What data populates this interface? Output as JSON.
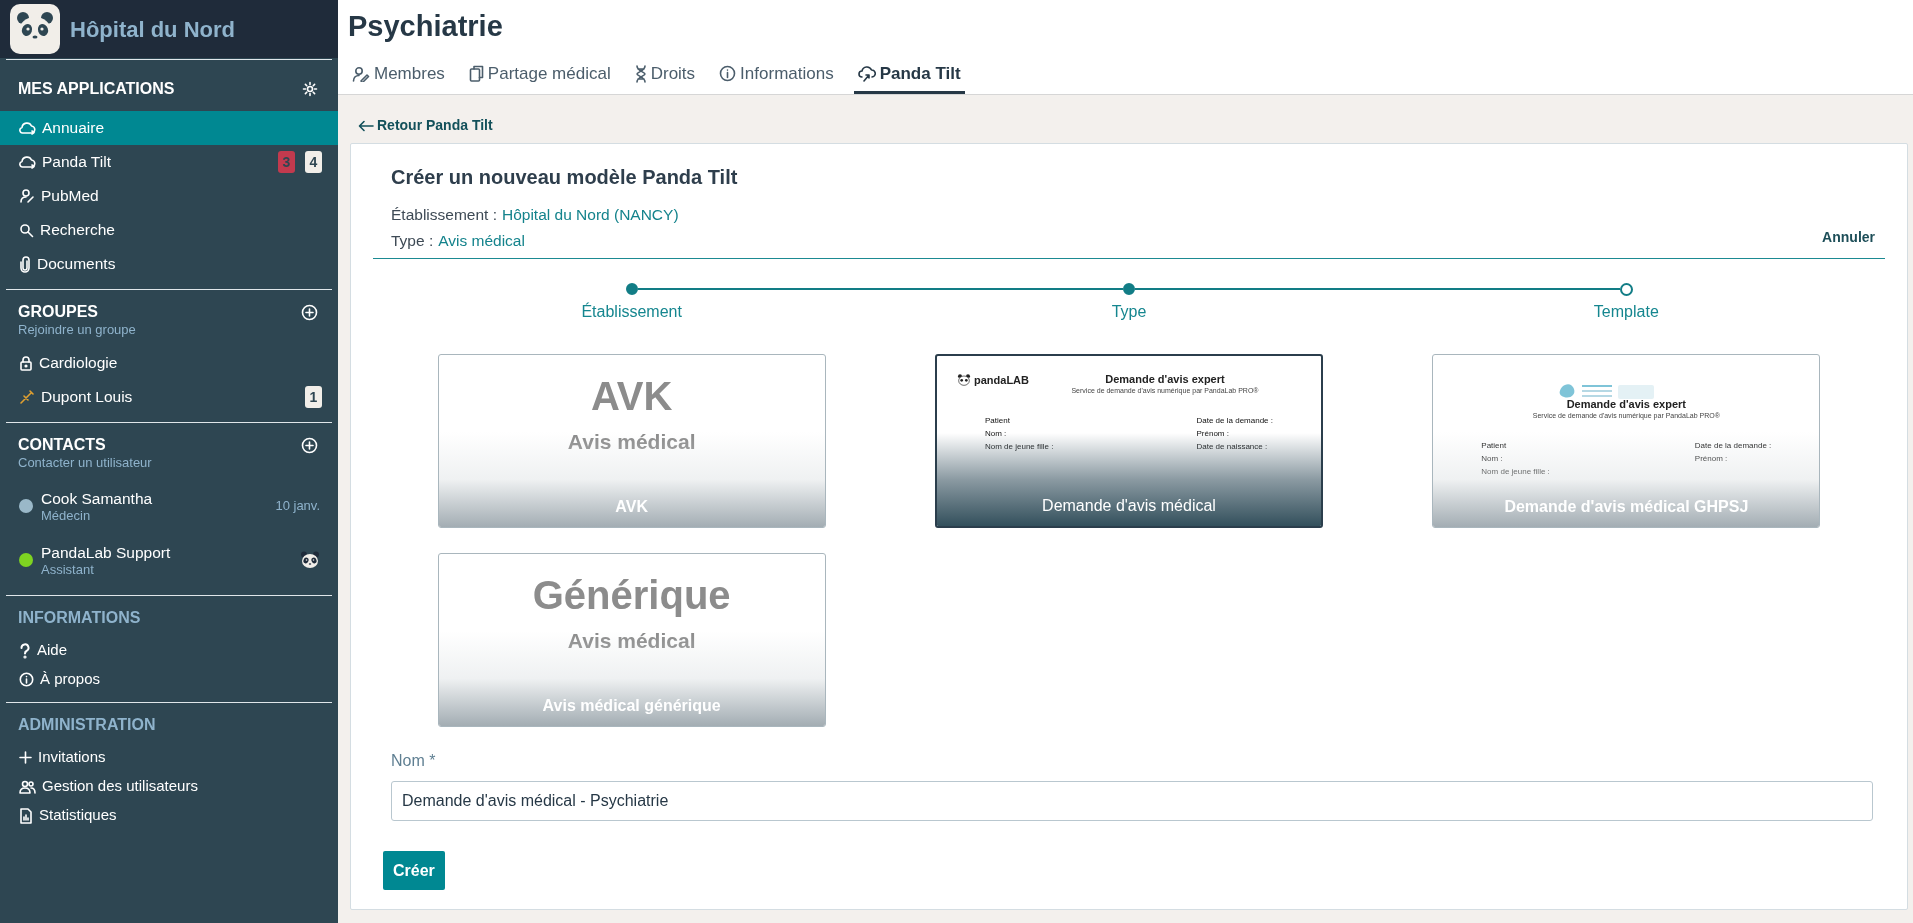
{
  "sidebar": {
    "org_name": "Hôpital du Nord",
    "sections": [
      {
        "title": "MES APPLICATIONS",
        "active": true,
        "items": [
          {
            "label": "Annuaire",
            "selected": true
          },
          {
            "label": "Panda Tilt",
            "selected": false,
            "badges": [
              {
                "text": "3",
                "color": "#c23a4e"
              },
              {
                "text": "4",
                "color": "#f1eee9"
              }
            ]
          },
          {
            "label": "PubMed",
            "selected": false
          },
          {
            "label": "Recherche",
            "selected": false
          },
          {
            "label": "Documents",
            "selected": false
          }
        ]
      },
      {
        "title": "GROUPES",
        "subtitle": "Rejoindre un groupe",
        "active": true,
        "items": [
          {
            "label": "Cardiologie",
            "selected": false
          },
          {
            "label": "Dupont Louis",
            "selected": false,
            "badges": [
              {
                "text": "1",
                "color": "#f1eee9"
              }
            ]
          }
        ]
      },
      {
        "title": "CONTACTS",
        "subtitle": "Contacter un utilisateur",
        "active": true,
        "contacts": [
          {
            "name": "Cook Samantha",
            "role": "Médecin",
            "color": "#9ab8c8",
            "date": "10 janv.",
            "has_avatar": false
          },
          {
            "name": "PandaLab Support",
            "role": "Assistant",
            "color": "#7ed321",
            "has_avatar": true
          }
        ]
      },
      {
        "title": "INFORMATIONS",
        "active": false,
        "items": [
          {
            "label": "Aide",
            "selected": false
          },
          {
            "label": "À propos",
            "selected": false
          }
        ]
      },
      {
        "title": "ADMINISTRATION",
        "active": false,
        "items": [
          {
            "label": "Invitations",
            "selected": false
          },
          {
            "label": "Gestion des utilisateurs",
            "selected": false
          },
          {
            "label": "Statistiques",
            "selected": false
          }
        ]
      }
    ]
  },
  "main": {
    "page_title": "Psychiatrie",
    "tabs": [
      {
        "label": "Membres",
        "selected": false
      },
      {
        "label": "Partage médical",
        "selected": false
      },
      {
        "label": "Droits",
        "selected": false
      },
      {
        "label": "Informations",
        "selected": false
      },
      {
        "label": "Panda Tilt",
        "selected": true
      }
    ],
    "back_link": "Retour Panda Tilt",
    "form": {
      "title": "Créer un nouveau modèle Panda Tilt",
      "establishment_label": "Établissement :",
      "establishment_value": "Hôpital du Nord (NANCY)",
      "type_label": "Type :",
      "type_value": "Avis médical",
      "cancel": "Annuler",
      "steps": [
        {
          "label": "Établissement",
          "done": true
        },
        {
          "label": "Type",
          "done": true
        },
        {
          "label": "Template",
          "done": false
        }
      ],
      "templates": [
        {
          "kind": "text",
          "selected": false,
          "title": "AVK",
          "subtitle": "Avis médical",
          "caption": "AVK"
        },
        {
          "kind": "document",
          "selected": true,
          "logo_text": "pandaLAB",
          "heading": "Demande d'avis expert",
          "subheading": "Service de demande d'avis numérique par PandaLab PRO®",
          "fields_left": [
            "Patient",
            "Nom :",
            "Nom de jeune fille :"
          ],
          "fields_right": [
            "Date de la demande :",
            "Prénom :",
            "Date de naissance :"
          ],
          "caption": "Demande d'avis médical"
        },
        {
          "kind": "document",
          "selected": false,
          "heading": "Demande d'avis expert",
          "subheading": "Service de demande d'avis numérique par PandaLab PRO®",
          "fields_left": [
            "Patient",
            "Nom :",
            "Nom de jeune fille :"
          ],
          "fields_right": [
            "Date de la demande :",
            "Prénom :"
          ],
          "caption": "Demande d'avis médical GHPSJ"
        },
        {
          "kind": "text",
          "selected": false,
          "title": "Générique",
          "subtitle": "Avis médical",
          "caption": "Avis médical générique"
        }
      ],
      "name_label": "Nom *",
      "name_value": "Demande d'avis médical - Psychiatrie",
      "submit": "Créer"
    }
  }
}
